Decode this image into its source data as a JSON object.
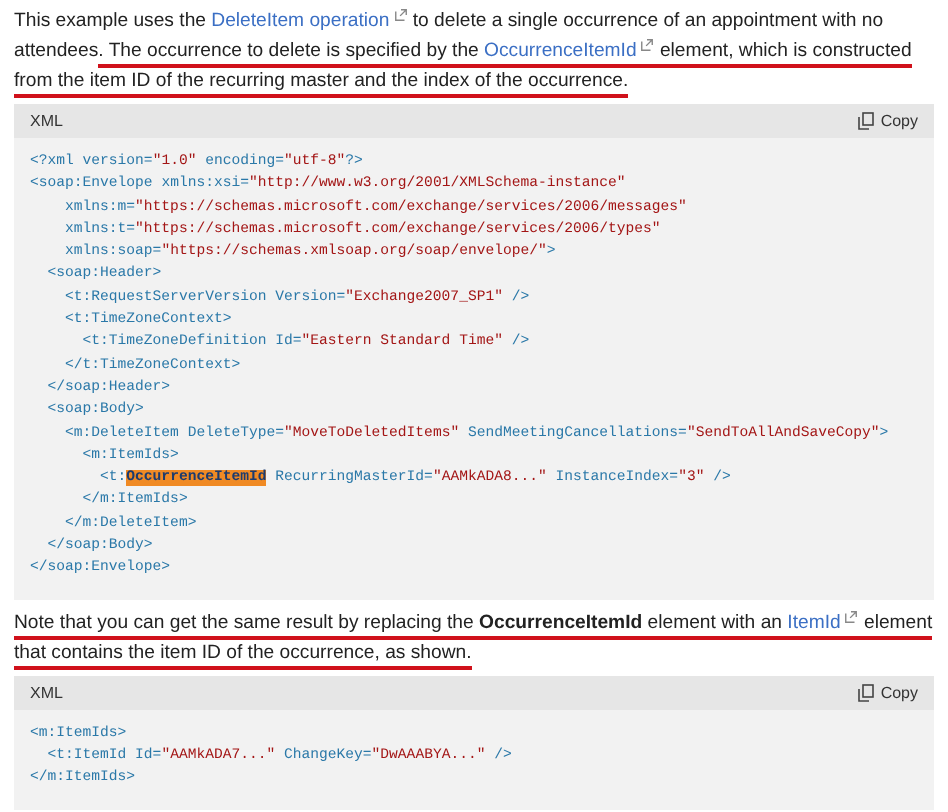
{
  "paragraphs": [
    {
      "segments": [
        {
          "text": "This example uses the ",
          "kind": "text",
          "underlined": false
        },
        {
          "text": "DeleteItem operation",
          "kind": "link",
          "underlined": false
        },
        {
          "text": " to delete a single occurrence of an appointment with no attendees",
          "kind": "text",
          "underlined": false
        },
        {
          "text": ". The occurrence to delete is specified by the ",
          "kind": "text",
          "underlined": true
        },
        {
          "text": "OccurrenceItemId",
          "kind": "link",
          "underlined": true
        },
        {
          "text": " element, which is constructed from the item ID of the recurring master and the index of the occurrence.",
          "kind": "text",
          "underlined": true
        }
      ]
    },
    {
      "segments": [
        {
          "text": "Note that you can get the same result by replacing the ",
          "kind": "text",
          "underlined": true
        },
        {
          "text": "OccurrenceItemId",
          "kind": "bold",
          "underlined": true
        },
        {
          "text": " element with an ",
          "kind": "text",
          "underlined": true
        },
        {
          "text": "ItemId",
          "kind": "link",
          "underlined": true
        },
        {
          "text": " element that contains the item ID of the occurrence, as shown.",
          "kind": "text",
          "underlined": true
        }
      ]
    }
  ],
  "code_blocks": [
    {
      "language": "XML",
      "copy_label": "Copy",
      "lines": [
        [
          {
            "kind": "tag",
            "text": "<?xml "
          },
          {
            "kind": "attr",
            "text": "version="
          },
          {
            "kind": "value",
            "text": "\"1.0\""
          },
          {
            "kind": "attr",
            "text": " encoding="
          },
          {
            "kind": "value",
            "text": "\"utf-8\""
          },
          {
            "kind": "tag",
            "text": "?>"
          }
        ],
        [
          {
            "kind": "tag",
            "text": "<soap:Envelope "
          },
          {
            "kind": "attr",
            "text": "xmlns:xsi="
          },
          {
            "kind": "value",
            "text": "\"http://www.w3.org/2001/XMLSchema-instance\""
          }
        ],
        [
          {
            "kind": "attr",
            "text": "    xmlns:m="
          },
          {
            "kind": "value",
            "text": "\"https://schemas.microsoft.com/exchange/services/2006/messages\""
          }
        ],
        [
          {
            "kind": "attr",
            "text": "    xmlns:t="
          },
          {
            "kind": "value",
            "text": "\"https://schemas.microsoft.com/exchange/services/2006/types\""
          }
        ],
        [
          {
            "kind": "attr",
            "text": "    xmlns:soap="
          },
          {
            "kind": "value",
            "text": "\"https://schemas.xmlsoap.org/soap/envelope/\""
          },
          {
            "kind": "tag",
            "text": ">"
          }
        ],
        [
          {
            "kind": "tag",
            "text": "  <soap:Header>"
          }
        ],
        [
          {
            "kind": "tag",
            "text": "    <t:RequestServerVersion "
          },
          {
            "kind": "attr",
            "text": "Version="
          },
          {
            "kind": "value",
            "text": "\"Exchange2007_SP1\""
          },
          {
            "kind": "tag",
            "text": " />"
          }
        ],
        [
          {
            "kind": "tag",
            "text": "    <t:TimeZoneContext>"
          }
        ],
        [
          {
            "kind": "tag",
            "text": "      <t:TimeZoneDefinition "
          },
          {
            "kind": "attr",
            "text": "Id="
          },
          {
            "kind": "value",
            "text": "\"Eastern Standard Time\""
          },
          {
            "kind": "tag",
            "text": " />"
          }
        ],
        [
          {
            "kind": "tag",
            "text": "    </t:TimeZoneContext>"
          }
        ],
        [
          {
            "kind": "tag",
            "text": "  </soap:Header>"
          }
        ],
        [
          {
            "kind": "tag",
            "text": "  <soap:Body>"
          }
        ],
        [
          {
            "kind": "tag",
            "text": "    <m:DeleteItem "
          },
          {
            "kind": "attr",
            "text": "DeleteType="
          },
          {
            "kind": "value",
            "text": "\"MoveToDeletedItems\""
          },
          {
            "kind": "attr",
            "text": " SendMeetingCancellations="
          },
          {
            "kind": "value",
            "text": "\"SendToAllAndSaveCopy\""
          },
          {
            "kind": "tag",
            "text": ">"
          }
        ],
        [
          {
            "kind": "tag",
            "text": "      <m:ItemIds>"
          }
        ],
        [
          {
            "kind": "tag",
            "text": "        <t:"
          },
          {
            "kind": "highlight",
            "text": "OccurrenceItemId"
          },
          {
            "kind": "attr",
            "text": " RecurringMasterId="
          },
          {
            "kind": "value",
            "text": "\"AAMkADA8...\""
          },
          {
            "kind": "attr",
            "text": " InstanceIndex="
          },
          {
            "kind": "value",
            "text": "\"3\""
          },
          {
            "kind": "tag",
            "text": " />"
          }
        ],
        [
          {
            "kind": "tag",
            "text": "      </m:ItemIds>"
          }
        ],
        [
          {
            "kind": "tag",
            "text": "    </m:DeleteItem>"
          }
        ],
        [
          {
            "kind": "tag",
            "text": "  </soap:Body>"
          }
        ],
        [
          {
            "kind": "tag",
            "text": "</soap:Envelope>"
          }
        ]
      ]
    },
    {
      "language": "XML",
      "copy_label": "Copy",
      "lines": [
        [
          {
            "kind": "tag",
            "text": "<m:ItemIds>"
          }
        ],
        [
          {
            "kind": "tag",
            "text": "  <t:ItemId "
          },
          {
            "kind": "attr",
            "text": "Id="
          },
          {
            "kind": "value",
            "text": "\"AAMkADA7...\""
          },
          {
            "kind": "attr",
            "text": " ChangeKey="
          },
          {
            "kind": "value",
            "text": "\"DwAAABYA...\""
          },
          {
            "kind": "tag",
            "text": " />"
          }
        ],
        [
          {
            "kind": "tag",
            "text": "</m:ItemIds>"
          }
        ]
      ]
    }
  ]
}
